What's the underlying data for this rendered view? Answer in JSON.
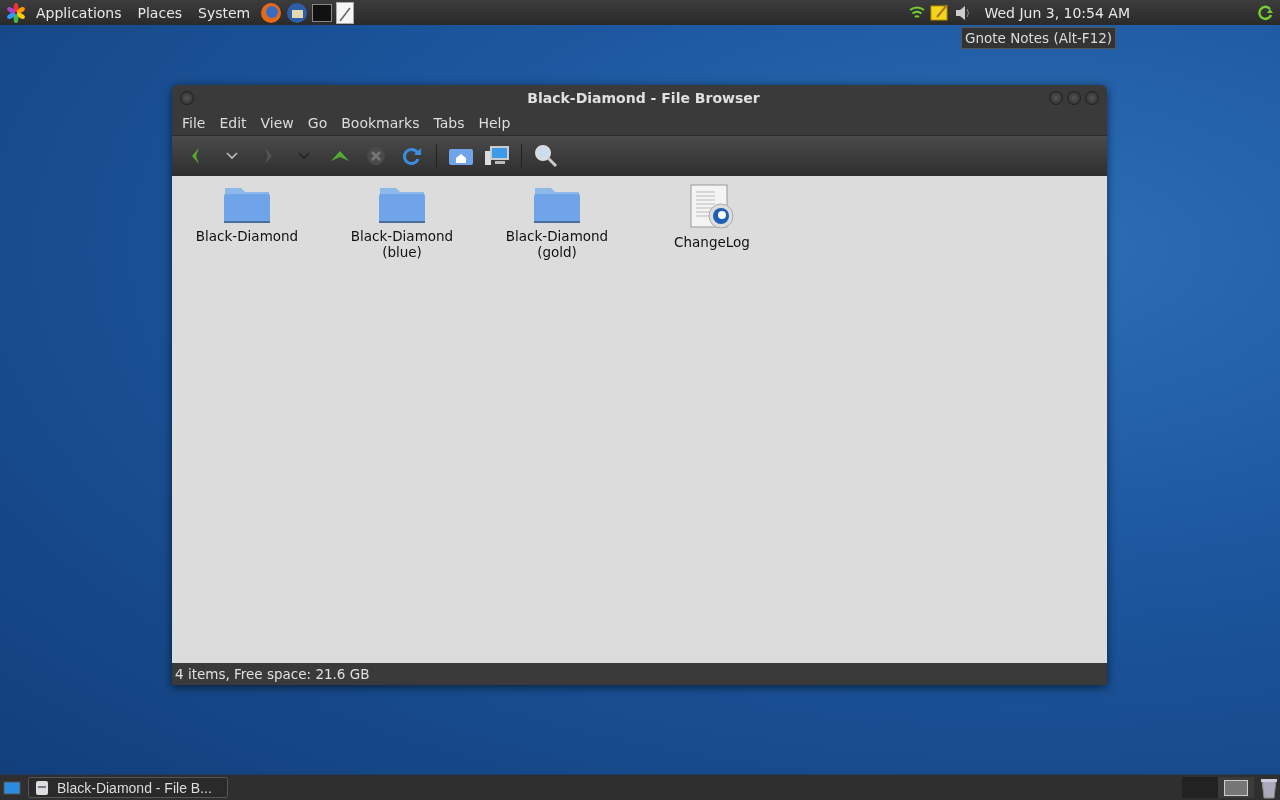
{
  "top_panel": {
    "menus": [
      "Applications",
      "Places",
      "System"
    ],
    "clock": "Wed Jun  3, 10:54 AM",
    "tooltip": "Gnote Notes (Alt-F12)"
  },
  "window": {
    "title": "Black-Diamond - File Browser",
    "menu": [
      "File",
      "Edit",
      "View",
      "Go",
      "Bookmarks",
      "Tabs",
      "Help"
    ],
    "items": [
      {
        "kind": "folder",
        "label": "Black-Diamond"
      },
      {
        "kind": "folder",
        "label": "Black-Diamond (blue)"
      },
      {
        "kind": "folder",
        "label": "Black-Diamond (gold)"
      },
      {
        "kind": "file",
        "label": "ChangeLog"
      }
    ],
    "status_bar": "4 items, Free space: 21.6 GB"
  },
  "taskbar": {
    "tasks": [
      {
        "label": "Black-Diamond - File B..."
      }
    ],
    "workspaces": [
      {
        "selected": false
      },
      {
        "selected": true
      }
    ]
  }
}
